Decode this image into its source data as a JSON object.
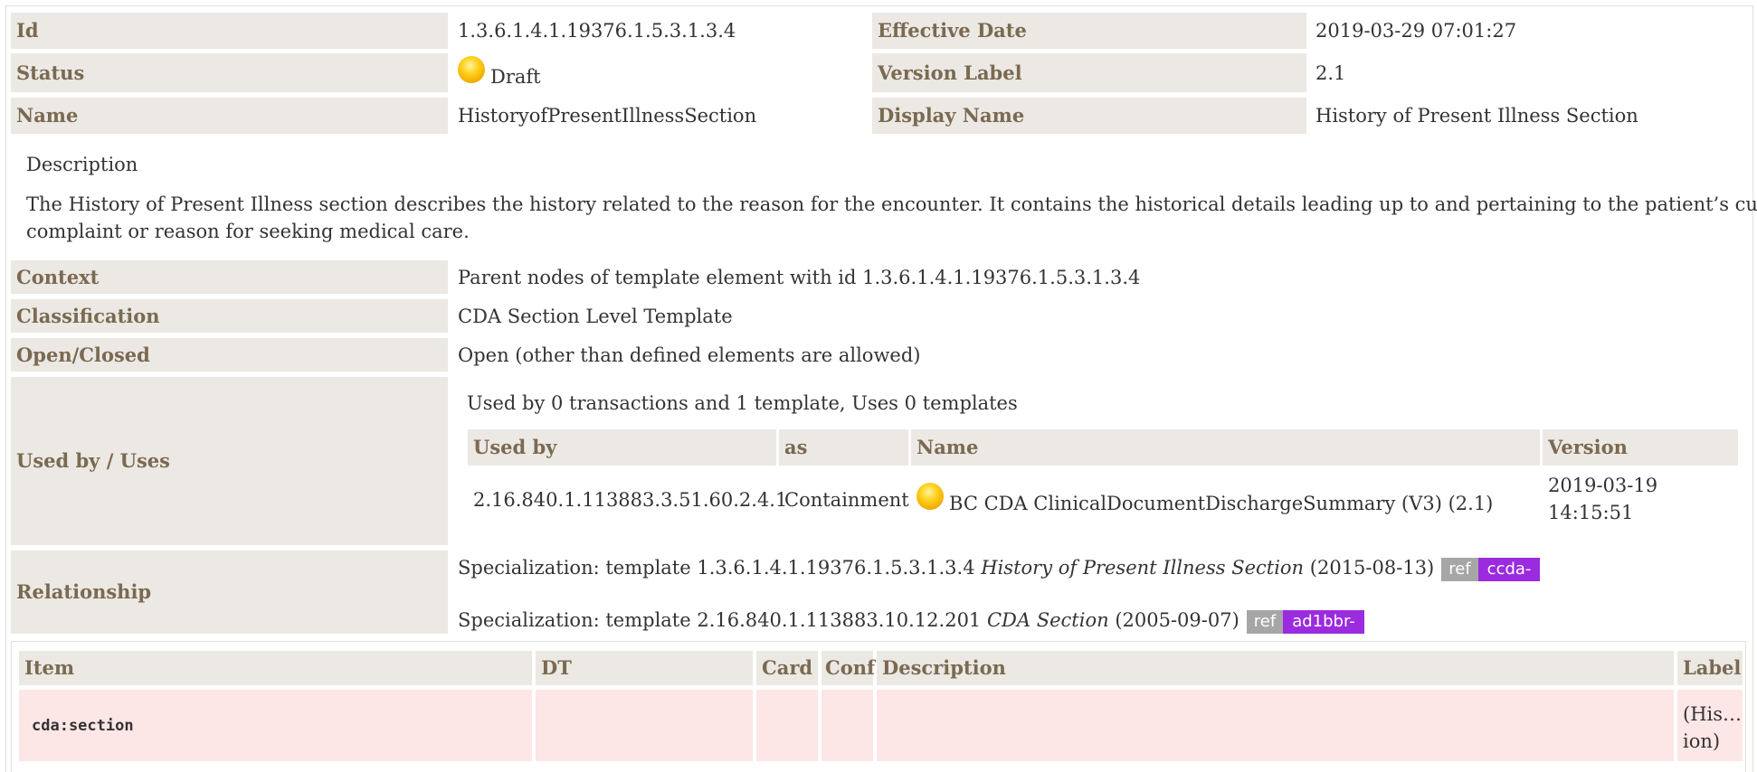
{
  "meta": {
    "id_label": "Id",
    "id_value": "1.3.6.1.4.1.19376.1.5.3.1.3.4",
    "effective_date_label": "Effective Date",
    "effective_date_value": "2019-03-29 07:01:27",
    "status_label": "Status",
    "status_value": "Draft",
    "version_label_label": "Version Label",
    "version_label_value": "2.1",
    "name_label": "Name",
    "name_value": "HistoryofPresentIllnessSection",
    "display_name_label": "Display Name",
    "display_name_value": "History of Present Illness Section"
  },
  "description": {
    "heading": "Description",
    "line1": "The History of Present Illness section describes the history related to the reason for the encounter. It contains the historical details leading up to and pertaining to the patient’s current",
    "line2": "complaint or reason for seeking medical care."
  },
  "details": {
    "context_label": "Context",
    "context_value": "Parent nodes of template element with id 1.3.6.1.4.1.19376.1.5.3.1.3.4",
    "classification_label": "Classification",
    "classification_value": "CDA Section Level Template",
    "open_closed_label": "Open/Closed",
    "open_closed_value": "Open (other than defined elements are allowed)"
  },
  "usage": {
    "label": "Used by / Uses",
    "summary": "Used by 0 transactions and 1 template, Uses 0 templates",
    "headers": {
      "used_by": "Used by",
      "as": "as",
      "name": "Name",
      "version": "Version"
    },
    "rows": [
      {
        "used_by": "2.16.840.1.113883.3.51.60.2.4.1",
        "as": "Containment",
        "name": "BC CDA ClinicalDocumentDischargeSummary (V3) (2.1)",
        "version_line1": "2019-03-19",
        "version_line2": "14:15:51"
      }
    ]
  },
  "relationship": {
    "label": "Relationship",
    "items": [
      {
        "prefix": "Specialization: template 1.3.6.1.4.1.19376.1.5.3.1.3.4",
        "title": "History of Present Illness Section",
        "date": "(2015-08-13)",
        "ref": "ref",
        "tag": "ccda-"
      },
      {
        "prefix": "Specialization: template 2.16.840.1.113883.10.12.201",
        "title": "CDA Section",
        "date": "(2005-09-07)",
        "ref": "ref",
        "tag": "ad1bbr-"
      }
    ]
  },
  "items_table": {
    "headers": {
      "item": "Item",
      "dt": "DT",
      "card": "Card",
      "conf": "Conf",
      "description": "Description",
      "label": "Label"
    },
    "rows": [
      {
        "item": "cda:section",
        "dt": "",
        "card": "",
        "conf": "",
        "description": "",
        "label_line1": "(His…",
        "label_line2": "ion)"
      }
    ]
  },
  "colors": {
    "header_bg": "#ece8e3",
    "header_text": "#7a6a52",
    "row_pink": "#fde6e6",
    "ref_tag": "#a6a6a6",
    "id_tag": "#9b2bdf",
    "status_orb": "#ffcc00"
  }
}
